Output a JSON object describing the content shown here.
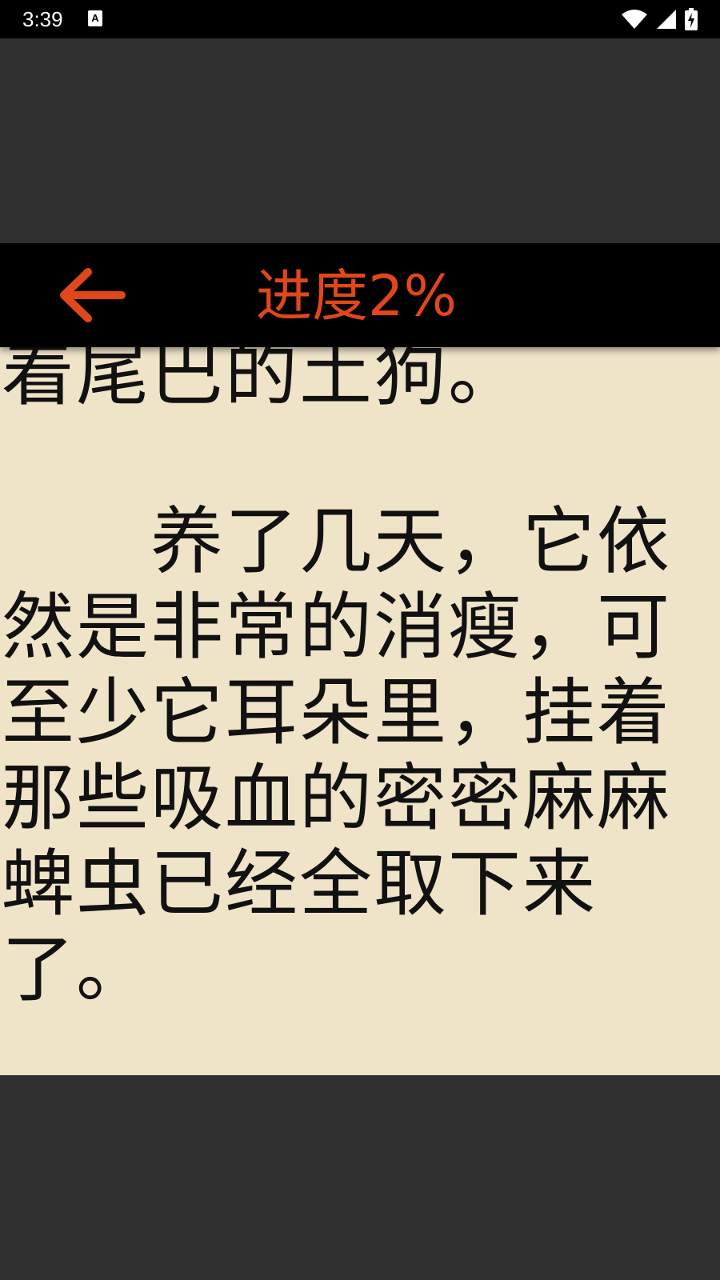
{
  "status_bar": {
    "time": "3:39",
    "notification_icon": "a-icon",
    "icons": [
      "wifi-icon",
      "signal-icon",
      "battery-icon"
    ]
  },
  "toolbar": {
    "back_icon": "arrow-left-icon",
    "progress_label": "进度2%",
    "accent_color": "#e0471b"
  },
  "reader": {
    "page_background": "#efe3c8",
    "previous_paragraph_tail": "着尾巴的土狗。",
    "paragraph": "　　养了几天，它依然是非常的消瘦，可至少它耳朵里，挂着那些吸血的密密麻麻蜱虫已经全取下来了。"
  }
}
